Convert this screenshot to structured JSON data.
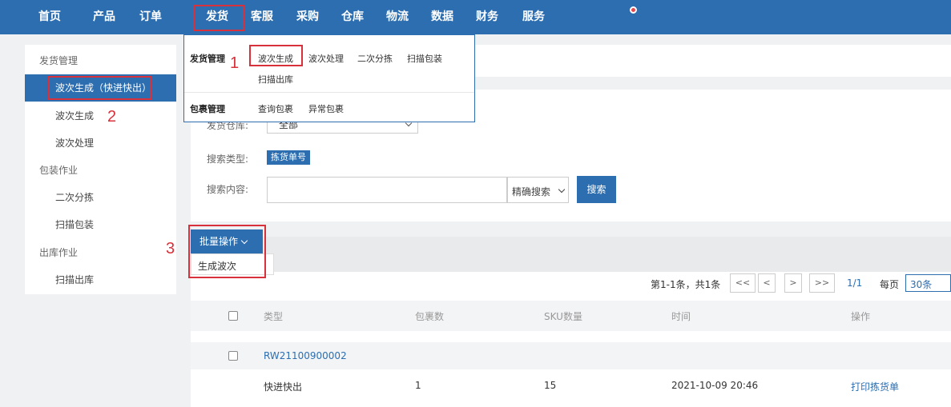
{
  "nav": {
    "items": [
      "首页",
      "产品",
      "订单",
      "发货",
      "客服",
      "采购",
      "仓库",
      "物流",
      "数据",
      "财务",
      "服务"
    ],
    "active_index": 3
  },
  "markers": [
    "1",
    "2",
    "3"
  ],
  "sidebar": {
    "groups": [
      {
        "label": "发货管理",
        "items": [
          "波次生成（快进快出）",
          "波次生成",
          "波次处理"
        ]
      },
      {
        "label": "包装作业",
        "items": [
          "二次分拣",
          "扫描包装"
        ]
      },
      {
        "label": "出库作业",
        "items": [
          "扫描出库"
        ]
      }
    ],
    "active_item": "波次生成（快进快出）"
  },
  "dropdown": {
    "section1_title": "发货管理",
    "section1_items": [
      "波次生成",
      "波次处理",
      "二次分拣",
      "扫描包装",
      "扫描出库"
    ],
    "section2_title": "包裹管理",
    "section2_items": [
      "查询包裹",
      "异常包裹"
    ]
  },
  "filters": {
    "warehouse_label": "发货仓库:",
    "warehouse_value": "全部",
    "search_type_label": "搜索类型:",
    "search_type_tag": "拣货单号",
    "search_content_label": "搜索内容:",
    "search_content_value": "",
    "match_mode": "精确搜索",
    "search_button": "搜索"
  },
  "batch": {
    "button": "批量操作",
    "menu_items": [
      "生成波次"
    ]
  },
  "pager": {
    "summary": "第1-1条，共1条",
    "first": "<<",
    "prev": "<",
    "next": ">",
    "last": ">>",
    "page": "1/1",
    "per_page_label": "每页",
    "per_page_value": "30条"
  },
  "table": {
    "headers": [
      "类型",
      "包裹数",
      "SKU数量",
      "时间",
      "操作"
    ],
    "group_id": "RW21100900002",
    "rows": [
      {
        "type": "快进快出",
        "packages": "1",
        "sku": "15",
        "time": "2021-10-09 20:46",
        "action": "打印拣货单"
      }
    ]
  },
  "colors": {
    "brand": "#2d6eb0",
    "annotation": "#d9313b",
    "link": "#2d6eb0"
  }
}
